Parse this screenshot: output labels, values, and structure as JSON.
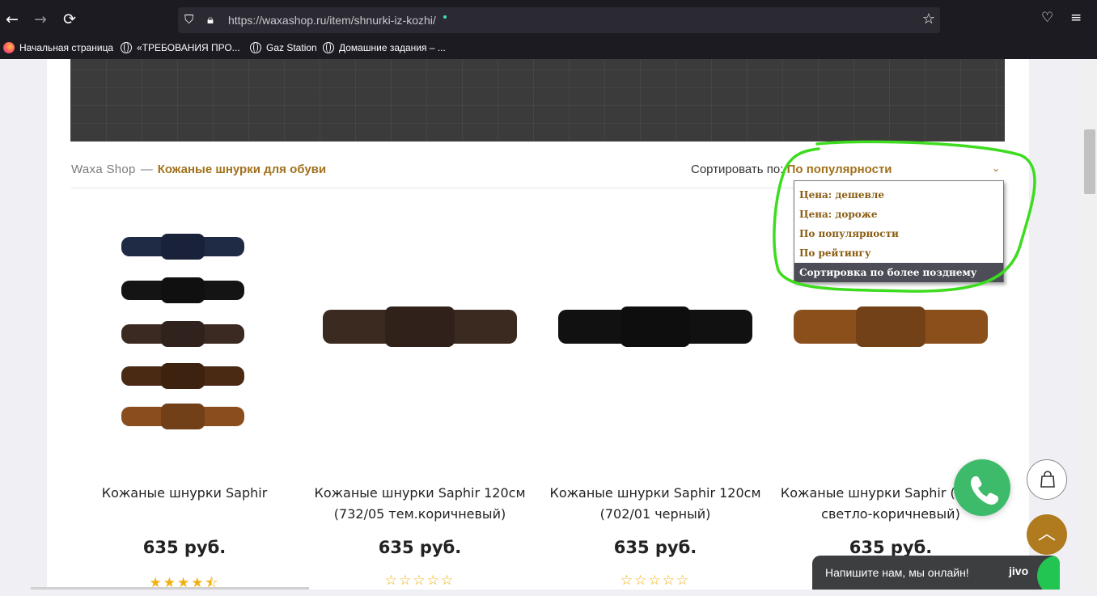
{
  "browser": {
    "url": "https://waxashop.ru/item/shnurki-iz-kozhi/",
    "bookmarks": [
      "Начальная страница",
      "«ТРЕБОВАНИЯ ПРО...",
      "Gaz Station",
      "Домашние задания – ..."
    ]
  },
  "breadcrumb": {
    "home": "Waxa Shop",
    "separator": "—",
    "current": "Кожаные шнурки для обуви"
  },
  "sort": {
    "label": "Сортировать по:",
    "value": "По популярности",
    "options": [
      "Цена: дешевле",
      "Цена: дороже",
      "По популярности",
      "По рейтингу",
      "Сортировка по более позднему"
    ],
    "highlighted_index": 4
  },
  "products": [
    {
      "name": "Кожаные шнурки Saphir",
      "price": "635 руб.",
      "rating": 4.5,
      "stars": "★★★★⯪"
    },
    {
      "name": "Кожаные шнурки Saphir 120см (732/05 тем.коричневый)",
      "price": "635 руб.",
      "rating": 0,
      "stars": "☆☆☆☆☆"
    },
    {
      "name": "Кожаные шнурки Saphir 120см (702/01 черный)",
      "price": "635 руб.",
      "rating": 0,
      "stars": "☆☆☆☆☆"
    },
    {
      "name": "Кожаные шнурки Saphir (39/700 светло-коричневый)",
      "price": "635 руб.",
      "rating": 0,
      "stars": "☆☆☆☆☆"
    }
  ],
  "chat": {
    "prompt": "Напишите нам, мы онлайн!",
    "brand": "jivo"
  },
  "colors": {
    "accent": "#a1711c",
    "annotation": "#3ddc1e",
    "call": "#3dbb6a",
    "chat": "#3c3e40"
  }
}
